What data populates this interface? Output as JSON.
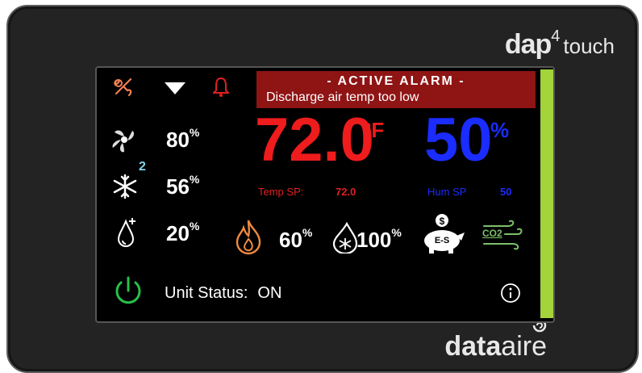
{
  "brand": {
    "dap": "dap",
    "version": "4",
    "touch": "touch",
    "maker_bold": "data",
    "maker_light": "aire"
  },
  "alarm": {
    "title": "- ACTIVE ALARM -",
    "message": "Discharge air temp too low",
    "color": "#8f1414"
  },
  "readings": {
    "fan": {
      "value": "80",
      "unit": "%"
    },
    "cooling": {
      "value": "56",
      "unit": "%",
      "stage": "2"
    },
    "humidifier": {
      "value": "20",
      "unit": "%"
    },
    "heat": {
      "value": "60",
      "unit": "%"
    },
    "dehum": {
      "value": "100",
      "unit": "%"
    }
  },
  "temperature": {
    "value": "72.0",
    "unit": "°F",
    "sp_label": "Temp SP:",
    "sp_value": "72.0",
    "color": "#ee1c1c"
  },
  "humidity": {
    "value": "50",
    "unit": "%",
    "sp_label": "Hum SP",
    "sp_value": "50",
    "color": "#1a2cff"
  },
  "economizer": {
    "label": "E-S"
  },
  "co2": {
    "label": "CO2"
  },
  "unit_status": {
    "label": "Unit Status:",
    "value": "ON"
  },
  "icons": [
    "maintenance-icon",
    "dropdown-arrow-icon",
    "alarm-bell-icon",
    "fan-icon",
    "snowflake-icon",
    "humidifier-drop-icon",
    "flame-icon",
    "dehumidify-drop-icon",
    "economizer-piggy-icon",
    "co2-wind-icon",
    "power-icon",
    "info-icon"
  ]
}
